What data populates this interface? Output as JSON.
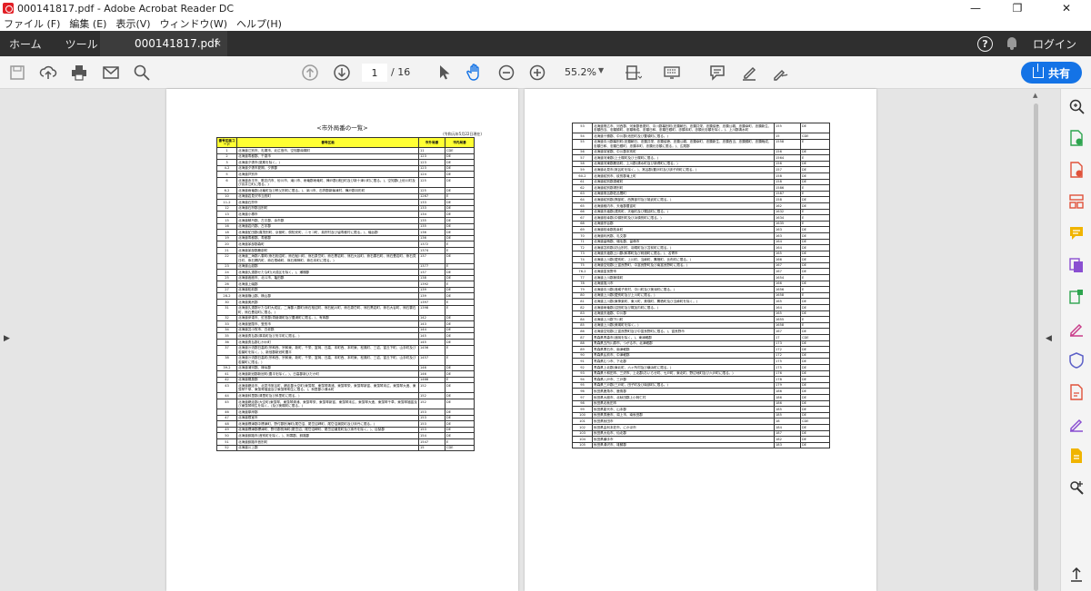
{
  "window": {
    "title": "000141817.pdf - Adobe Acrobat Reader DC",
    "minimize": "—",
    "maximize": "❐",
    "close": "✕"
  },
  "menu": [
    "ファイル (F)",
    "編集 (E)",
    "表示(V)",
    "ウィンドウ(W)",
    "ヘルプ(H)"
  ],
  "tabs": {
    "home": "ホーム",
    "tools": "ツール",
    "document": "000141817.pdf",
    "close": "×",
    "login": "ログイン",
    "help": "?"
  },
  "toolbar": {
    "page_current": "1",
    "page_total": "/ 16",
    "zoom": "55.2%",
    "zoom_caret": "▼",
    "share_label": "共有"
  },
  "colors": {
    "accent": "#1473e6",
    "tab_bar": "#2f2f2f",
    "table_header": "#ffff33"
  },
  "document": {
    "title": "<市外局番の一覧>",
    "date": "(令和元年5月22日現在)",
    "headers": [
      "番号区画コード",
      "番号区画",
      "市外局番",
      "市内局番"
    ],
    "page1_rows": [
      [
        "1",
        "北海道江別市、札幌市、北広島市、空知郡南幌町",
        "11",
        "CDE"
      ],
      [
        "2",
        "北海道寿都郡、千歳市",
        "123",
        "DE"
      ],
      [
        "3",
        "北海道夕張市(夏期を除く。)",
        "123",
        "DE"
      ],
      [
        "4-2",
        "北海道夕張市夏期、夕張郡",
        "123",
        "DE"
      ],
      [
        "5",
        "北海道芦別市",
        "124",
        "DE"
      ],
      [
        "6",
        "北海道赤平市、歌志内市、砂川市、滝川市、雨竜郡雨竜町、樺戸郡(浦臼町及び新十津川町に限る。)、空知郡(上砂川町及び奈井江町に限る。)",
        "125",
        "DE"
      ],
      [
        "6-2",
        "北海道雨竜郡(北竜町及び秩父別町に限る。)、深川市、石狩郡新篠津村、樺戸郡月形町",
        "125",
        "DE"
      ],
      [
        "10",
        "北海道岩見沢市当別町",
        "1267",
        "E"
      ],
      [
        "11-2",
        "北海道石狩市",
        "133",
        "DE"
      ],
      [
        "12",
        "北海道石狩郡当別町",
        "133",
        "DE"
      ],
      [
        "13",
        "北海道小樽市",
        "134",
        "DE"
      ],
      [
        "15",
        "北海道積丹郡、古平郡、余市郡",
        "135",
        "DE"
      ],
      [
        "16",
        "北海道岩内郡、古宇郡",
        "135",
        "DE"
      ],
      [
        "18",
        "北海道虻田郡(喜茂別町、京極町、倶知安町、ニセコ町、真狩村及び留寿都村に限る。)、磯谷郡",
        "136",
        "DE"
      ],
      [
        "19",
        "北海道寿都郡、寿都郡",
        "136",
        "DE"
      ],
      [
        "20",
        "北海道茅部郡森町",
        "1372",
        "E"
      ],
      [
        "21",
        "北海道茅部郡鹿部町",
        "1374",
        "E"
      ],
      [
        "22",
        "北海道二海郡八雲町(熊石相沼町、熊石鮎川町、熊石泉岱町、熊石黒岩町、熊石大谷町、熊石雲石町、熊石畳岩町、熊石見日町、熊石関内町、熊石根崎町、熊石鳴神町、熊石本町に限る。)",
        "137",
        "DE"
      ],
      [
        "23",
        "北海道山越郡",
        "1377",
        "E"
      ],
      [
        "24",
        "北海道久遠郡せたな町(大成区を除く。)、瀬棚郡",
        "137",
        "DE"
      ],
      [
        "25",
        "北海道函館市、北斗市、亀田郡",
        "138",
        "DE"
      ],
      [
        "26",
        "北海道上磯郡",
        "1392",
        "E"
      ],
      [
        "27",
        "北海道松前郡",
        "139",
        "DE"
      ],
      [
        "28-2",
        "北海道檜山郡、檜山郡",
        "139",
        "DE"
      ],
      [
        "30",
        "北海道奥尻郡",
        "1397",
        "E"
      ],
      [
        "31",
        "北海道久遠郡せたな町大成区、二海郡八雲町(熊石相沼町、熊石鮎川町、熊石泉岱町、熊石黒岩町、熊石大谷町、熊石雲石町、熊石畳岩町に限る。)",
        "1398",
        "E"
      ],
      [
        "32",
        "北海道伊達市、虻田郡(洞爺湖町及び豊浦町に限る。)、有珠郡",
        "142",
        "DE"
      ],
      [
        "33",
        "北海道室蘭市、登別市",
        "143",
        "DE"
      ],
      [
        "34",
        "北海道苫小牧市、白老郡",
        "144",
        "DE"
      ],
      [
        "35",
        "北海道勇払郡(厚真町及び安平町に限る。)",
        "145",
        "DE"
      ],
      [
        "36",
        "北海道勇払郡むかわ町",
        "145",
        "DE"
      ],
      [
        "37",
        "北海道沙流郡日高町(宗和西、宗和東、新町、千栄、富岡、日高、本町西、本町東、松風町、三岩、富丘下町、山手町及び若葉町を除く。)、新冠郡新冠町豊平",
        "1456",
        "E"
      ],
      [
        "38",
        "北海道沙流郡日高町(宗和西、宗和東、新町、千栄、富岡、日高、本町西、本町東、松風町、三岩、富丘下町、山手町及び若葉町に限る。)",
        "1457",
        "E"
      ],
      [
        "39-2",
        "北海道浦河郡、様似郡",
        "146",
        "DE"
      ],
      [
        "41",
        "北海道新冠郡新冠町(豊平を除く。)、日高郡新ひだか町",
        "146",
        "DE"
      ],
      [
        "42",
        "北海道幌泉郡",
        "1466",
        "E"
      ],
      [
        "43",
        "北海道網走市、北見市常呂町、網走郡大空町(東藻琴、東藻琴清浦、東藻琴栄、東藻琴新富、東藻琴末広、東藻琴大進、東藻琴千草、東藻琴福富及び東藻琴明生に限る。)、斜里郡小清水町",
        "152",
        "DE"
      ],
      [
        "44",
        "北海道斜里郡(清里町及び斜里町に限る。)",
        "152",
        "DE"
      ],
      [
        "45",
        "北海道網走郡(大空町(東藻琴、東藻琴清浦、東藻琴栄、東藻琴新富、東藻琴末広、東藻琴大進、東藻琴千草、東藻琴福富及び東藻琴明生を除く。)及び美幌町に限る。)",
        "152",
        "DE"
      ],
      [
        "46",
        "北海道厚岸郡",
        "153",
        "DE"
      ],
      [
        "47",
        "北海道根室市",
        "153",
        "DE"
      ],
      [
        "48",
        "北海道標津郡中標津町、野付郡別海町(尾岱沼、尾岱沼岬町、尾岱沼潮見町及び床丹に限る。)",
        "153",
        "DE"
      ],
      [
        "49",
        "北海道標津郡標津町、野付郡別海町(尾岱沼、尾岱沼岬町、尾岱沼潮見町及び床丹を除く。)、目梨郡",
        "153",
        "DE"
      ],
      [
        "50",
        "北海道釧路市(音別町を除く。)、阿寒郡、釧路郡",
        "154",
        "DE"
      ],
      [
        "51",
        "北海道釧路市音別町",
        "1547",
        "E"
      ],
      [
        "52",
        "北海道川上郡",
        "15",
        "CDE"
      ]
    ],
    "page2_rows": [
      [
        "53",
        "北海道帯広市、河西郡、河東郡音更町、中川郡幕別町(忠類朝日、忠類共栄、忠類協徳、忠類公親、忠類幸町、忠類新生、忠類西当、忠類錦町、忠類晩成、忠類日和、忠類白銀町、忠類本町、忠類元忠類を除く。)、上川郡清水町",
        "155",
        "DE"
      ],
      [
        "54",
        "北海道十勝郡、中川郡(池田町及び豊頃町に限る。)",
        "15",
        "CDE"
      ],
      [
        "55",
        "北海道中川郡幕別町(忠類朝日、忠類共栄、忠類協徳、忠類公親、忠類幸町、忠類新生、忠類西当、忠類錦町、忠類晩成、忠類日和、忠類白銀町、忠類本町、忠類元忠類に限る。)、広尾郡",
        "1558",
        "E"
      ],
      [
        "56",
        "北海道芽室郡、中川郡本別町",
        "156",
        "DE"
      ],
      [
        "57",
        "北海道河東郡(上士幌町及び士幌町に限る。)",
        "1564",
        "E"
      ],
      [
        "58",
        "北海道河東郡鹿追町、上川郡(清水町及び新得町に限る。)",
        "156",
        "DE"
      ],
      [
        "59",
        "北海道北見市(常呂町を除く。)、常呂郡(置戸町及び訓子府町に限る。)",
        "157",
        "DE"
      ],
      [
        "60-2",
        "北海道紋別市、紋別郡滝上町",
        "158",
        "DE"
      ],
      [
        "61",
        "北海道紋別郡遠軽町",
        "158",
        "DE"
      ],
      [
        "62",
        "北海道紋別郡湧別町",
        "1586",
        "E"
      ],
      [
        "63",
        "北海道常呂郡佐呂間町",
        "1587",
        "E"
      ],
      [
        "64",
        "北海道紋別郡(興部町、西興部村及び雄武町に限る。)",
        "158",
        "DE"
      ],
      [
        "65",
        "北海道稚内市、天塩郡豊富町",
        "162",
        "DE"
      ],
      [
        "66",
        "北海道天塩郡(遠別町、天塩町及び幌延町に限る。)",
        "1632",
        "E"
      ],
      [
        "67",
        "北海道枝幸郡(中頓別町及び浜頓別町に限る。)",
        "1634",
        "E"
      ],
      [
        "68",
        "北海道宗谷郡",
        "1635",
        "E"
      ],
      [
        "69",
        "北海道枝幸郡枝幸町",
        "163",
        "DE"
      ],
      [
        "70",
        "北海道利尻郡、礼文郡",
        "163",
        "DE"
      ],
      [
        "71",
        "北海道留萌郡、増毛郡、留萌市",
        "164",
        "DE"
      ],
      [
        "72",
        "北海道苫前郡(初山別村、羽幌町及び苫前町に限る。)",
        "164",
        "DE"
      ],
      [
        "73",
        "北海道天塩郡上川郡(和寒町及び剣淵町に限る。)、名寄市",
        "165",
        "DE"
      ],
      [
        "74",
        "北海道上川郡(愛別町、上川町、当麻町、鷹栖町、比布町に限る。)",
        "166",
        "DE"
      ],
      [
        "75",
        "北海道空知郡(上富良野町、中富良野町及び南富良野町に限る。)",
        "167",
        "DE"
      ],
      [
        "76-2",
        "北海道富良野市",
        "167",
        "DE"
      ],
      [
        "77",
        "北海道上川郡美瑛町",
        "1654",
        "E"
      ],
      [
        "78",
        "北海道旭川市",
        "166",
        "DE"
      ],
      [
        "79",
        "北海道中川郡(音威子府村、中川町及び美深町に限る。)",
        "1656",
        "E"
      ],
      [
        "80",
        "北海道上川郡(愛別町及び上川町に限る。)",
        "1658",
        "E"
      ],
      [
        "81",
        "北海道上川郡(東神楽町、東川町、美瑛町、鷹栖町及び当麻町を除く。)",
        "165",
        "DE"
      ],
      [
        "82",
        "北海道雨竜郡(沼田町及び幌加内町に限る。)",
        "164",
        "DE"
      ],
      [
        "83",
        "北海道天塩郡、中川郡",
        "165",
        "DE"
      ],
      [
        "84",
        "北海道上川郡下川町",
        "1655",
        "E"
      ],
      [
        "85",
        "北海道上川郡(美瑛町を除く。)",
        "1658",
        "E"
      ],
      [
        "86",
        "北海道空知郡(上富良野町及び中富良野町に限る。)、富良野市",
        "167",
        "DE"
      ],
      [
        "87",
        "青森県青森市(浪岡を除く。)、東津軽郡",
        "17",
        "CDE"
      ],
      [
        "88",
        "青森県五所川原市、つがる市、北津軽郡",
        "173",
        "DE"
      ],
      [
        "89",
        "青森県黒石市、南津軽郡",
        "172",
        "DE"
      ],
      [
        "90",
        "青森県弘前市、中津軽郡",
        "172",
        "DE"
      ],
      [
        "91",
        "青森県むつ市、下北郡",
        "175",
        "DE"
      ],
      [
        "92",
        "青森県上北郡(東北町、六ヶ所村及び横浜町に限る。)",
        "175",
        "DE"
      ],
      [
        "93",
        "青森県十和田市、三沢市、上北郡(おいらせ町、七戸町、東北町、野辺地町及び六戸町に限る。)",
        "176",
        "DE"
      ],
      [
        "94",
        "青森県八戸市、三戸郡",
        "178",
        "DE"
      ],
      [
        "95",
        "青森県三戸郡(三戸町、田子町及び南部町に限る。)",
        "179",
        "DE"
      ],
      [
        "96",
        "秋田県鹿角市、鹿角郡",
        "186",
        "DE"
      ],
      [
        "97",
        "秋田県大館市、北秋田郡上小阿仁村",
        "186",
        "DE"
      ],
      [
        "98",
        "秋田県北秋田市",
        "186",
        "DE"
      ],
      [
        "99",
        "秋田県能代市、山本郡",
        "185",
        "DE"
      ],
      [
        "100",
        "秋田県男鹿市、潟上市、南秋田郡",
        "185",
        "DE"
      ],
      [
        "101",
        "秋田県秋田市",
        "18",
        "CDE"
      ],
      [
        "102",
        "秋田県由利本荘市、にかほ市",
        "184",
        "DE"
      ],
      [
        "103",
        "秋田県大仙市、仙北郡",
        "187",
        "DE"
      ],
      [
        "104",
        "秋田県横手市",
        "182",
        "DE"
      ],
      [
        "105",
        "秋田県湯沢市、雄勝郡",
        "183",
        "DE"
      ]
    ]
  }
}
